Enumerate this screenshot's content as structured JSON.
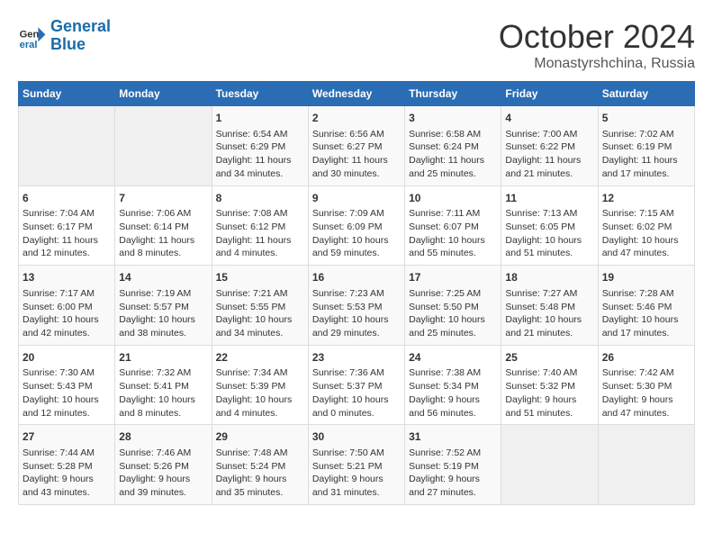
{
  "header": {
    "logo_line1": "General",
    "logo_line2": "Blue",
    "title": "October 2024",
    "subtitle": "Monastyrshchina, Russia"
  },
  "weekdays": [
    "Sunday",
    "Monday",
    "Tuesday",
    "Wednesday",
    "Thursday",
    "Friday",
    "Saturday"
  ],
  "weeks": [
    [
      {
        "day": "",
        "info": ""
      },
      {
        "day": "",
        "info": ""
      },
      {
        "day": "1",
        "info": "Sunrise: 6:54 AM\nSunset: 6:29 PM\nDaylight: 11 hours\nand 34 minutes."
      },
      {
        "day": "2",
        "info": "Sunrise: 6:56 AM\nSunset: 6:27 PM\nDaylight: 11 hours\nand 30 minutes."
      },
      {
        "day": "3",
        "info": "Sunrise: 6:58 AM\nSunset: 6:24 PM\nDaylight: 11 hours\nand 25 minutes."
      },
      {
        "day": "4",
        "info": "Sunrise: 7:00 AM\nSunset: 6:22 PM\nDaylight: 11 hours\nand 21 minutes."
      },
      {
        "day": "5",
        "info": "Sunrise: 7:02 AM\nSunset: 6:19 PM\nDaylight: 11 hours\nand 17 minutes."
      }
    ],
    [
      {
        "day": "6",
        "info": "Sunrise: 7:04 AM\nSunset: 6:17 PM\nDaylight: 11 hours\nand 12 minutes."
      },
      {
        "day": "7",
        "info": "Sunrise: 7:06 AM\nSunset: 6:14 PM\nDaylight: 11 hours\nand 8 minutes."
      },
      {
        "day": "8",
        "info": "Sunrise: 7:08 AM\nSunset: 6:12 PM\nDaylight: 11 hours\nand 4 minutes."
      },
      {
        "day": "9",
        "info": "Sunrise: 7:09 AM\nSunset: 6:09 PM\nDaylight: 10 hours\nand 59 minutes."
      },
      {
        "day": "10",
        "info": "Sunrise: 7:11 AM\nSunset: 6:07 PM\nDaylight: 10 hours\nand 55 minutes."
      },
      {
        "day": "11",
        "info": "Sunrise: 7:13 AM\nSunset: 6:05 PM\nDaylight: 10 hours\nand 51 minutes."
      },
      {
        "day": "12",
        "info": "Sunrise: 7:15 AM\nSunset: 6:02 PM\nDaylight: 10 hours\nand 47 minutes."
      }
    ],
    [
      {
        "day": "13",
        "info": "Sunrise: 7:17 AM\nSunset: 6:00 PM\nDaylight: 10 hours\nand 42 minutes."
      },
      {
        "day": "14",
        "info": "Sunrise: 7:19 AM\nSunset: 5:57 PM\nDaylight: 10 hours\nand 38 minutes."
      },
      {
        "day": "15",
        "info": "Sunrise: 7:21 AM\nSunset: 5:55 PM\nDaylight: 10 hours\nand 34 minutes."
      },
      {
        "day": "16",
        "info": "Sunrise: 7:23 AM\nSunset: 5:53 PM\nDaylight: 10 hours\nand 29 minutes."
      },
      {
        "day": "17",
        "info": "Sunrise: 7:25 AM\nSunset: 5:50 PM\nDaylight: 10 hours\nand 25 minutes."
      },
      {
        "day": "18",
        "info": "Sunrise: 7:27 AM\nSunset: 5:48 PM\nDaylight: 10 hours\nand 21 minutes."
      },
      {
        "day": "19",
        "info": "Sunrise: 7:28 AM\nSunset: 5:46 PM\nDaylight: 10 hours\nand 17 minutes."
      }
    ],
    [
      {
        "day": "20",
        "info": "Sunrise: 7:30 AM\nSunset: 5:43 PM\nDaylight: 10 hours\nand 12 minutes."
      },
      {
        "day": "21",
        "info": "Sunrise: 7:32 AM\nSunset: 5:41 PM\nDaylight: 10 hours\nand 8 minutes."
      },
      {
        "day": "22",
        "info": "Sunrise: 7:34 AM\nSunset: 5:39 PM\nDaylight: 10 hours\nand 4 minutes."
      },
      {
        "day": "23",
        "info": "Sunrise: 7:36 AM\nSunset: 5:37 PM\nDaylight: 10 hours\nand 0 minutes."
      },
      {
        "day": "24",
        "info": "Sunrise: 7:38 AM\nSunset: 5:34 PM\nDaylight: 9 hours\nand 56 minutes."
      },
      {
        "day": "25",
        "info": "Sunrise: 7:40 AM\nSunset: 5:32 PM\nDaylight: 9 hours\nand 51 minutes."
      },
      {
        "day": "26",
        "info": "Sunrise: 7:42 AM\nSunset: 5:30 PM\nDaylight: 9 hours\nand 47 minutes."
      }
    ],
    [
      {
        "day": "27",
        "info": "Sunrise: 7:44 AM\nSunset: 5:28 PM\nDaylight: 9 hours\nand 43 minutes."
      },
      {
        "day": "28",
        "info": "Sunrise: 7:46 AM\nSunset: 5:26 PM\nDaylight: 9 hours\nand 39 minutes."
      },
      {
        "day": "29",
        "info": "Sunrise: 7:48 AM\nSunset: 5:24 PM\nDaylight: 9 hours\nand 35 minutes."
      },
      {
        "day": "30",
        "info": "Sunrise: 7:50 AM\nSunset: 5:21 PM\nDaylight: 9 hours\nand 31 minutes."
      },
      {
        "day": "31",
        "info": "Sunrise: 7:52 AM\nSunset: 5:19 PM\nDaylight: 9 hours\nand 27 minutes."
      },
      {
        "day": "",
        "info": ""
      },
      {
        "day": "",
        "info": ""
      }
    ]
  ]
}
